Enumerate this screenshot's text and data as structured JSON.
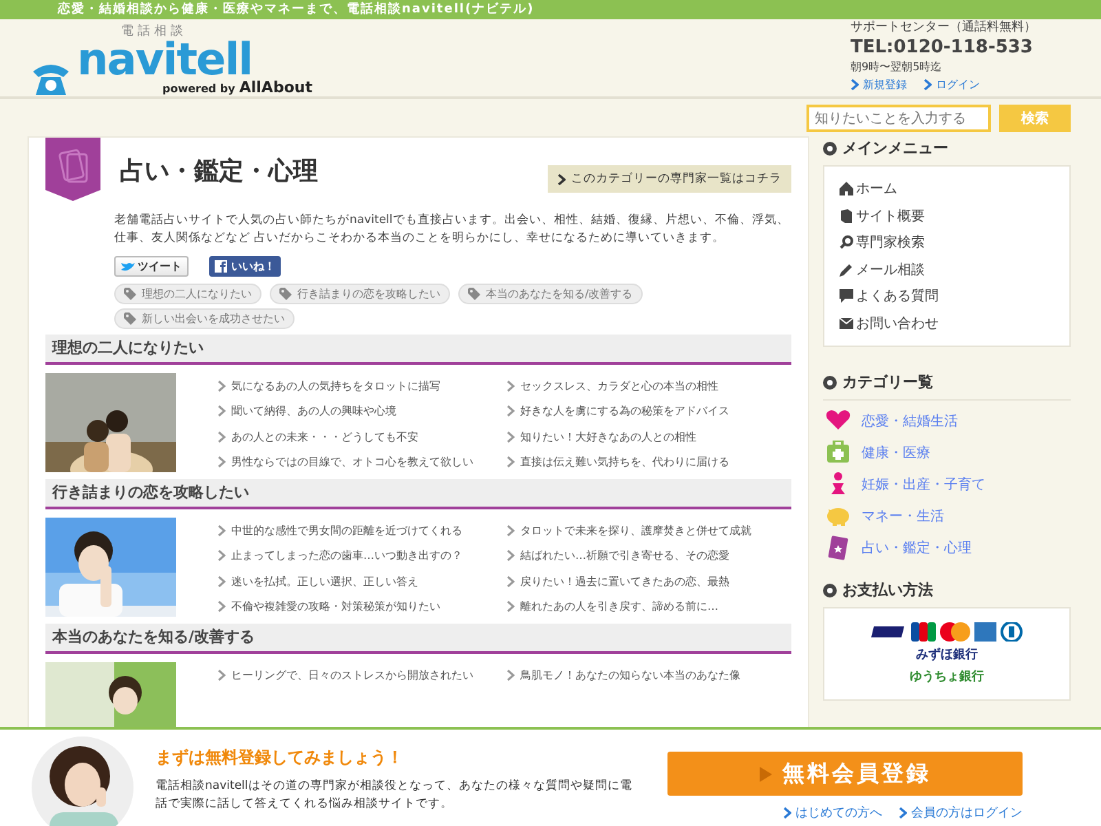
{
  "top_banner": "恋愛・結婚相談から健康・医療やマネーまで、電話相談navitell(ナビテル)",
  "logo": {
    "caption": "電話相談",
    "name": "navitell",
    "powered": "powered by",
    "brand": "AllAbout"
  },
  "support": {
    "title": "サポートセンター（通話料無料）",
    "tel": "TEL:0120-118-533",
    "hours": "朝9時〜翌朝5時迄",
    "links": [
      "新規登録",
      "ログイン"
    ]
  },
  "search": {
    "placeholder": "知りたいことを入力する",
    "button": "検索"
  },
  "category": {
    "title": "占い・鑑定・心理",
    "expert_link": "このカテゴリーの専門家一覧はコチラ",
    "description": "老舗電話占いサイトで人気の占い師たちがnavitellでも直接占います。出会い、相性、結婚、復縁、片想い、不倫、浮気、仕事、友人関係などなど 占いだからこそわかる本当のことを明らかにし、幸せになるために導いていきます。",
    "share": [
      {
        "kind": "tweet",
        "label": "ツイート"
      },
      {
        "kind": "like",
        "label": "いいね！"
      }
    ],
    "tags": [
      "理想の二人になりたい",
      "行き詰まりの恋を攻略したい",
      "本当のあなたを知る/改善する",
      "新しい出会いを成功させたい"
    ]
  },
  "sections": [
    {
      "heading": "理想の二人になりたい",
      "items": [
        "気になるあの人の気持ちをタロットに描写",
        "セックスレス、カラダと心の本当の相性",
        "聞いて納得、あの人の興味や心境",
        "好きな人を虜にする為の秘策をアドバイス",
        "あの人との未来・・・どうしても不安",
        "知りたい！大好きなあの人との相性",
        "男性ならではの目線で、オトコ心を教えて欲しい",
        "直接は伝え難い気持ちを、代わりに届ける"
      ]
    },
    {
      "heading": "行き詰まりの恋を攻略したい",
      "items": [
        "中世的な感性で男女間の距離を近づけてくれる",
        "タロットで未来を探り、護摩焚きと併せて成就",
        "止まってしまった恋の歯車…いつ動き出すの？",
        "結ばれたい…祈願で引き寄せる、その恋愛",
        "迷いを払拭。正しい選択、正しい答え",
        "戻りたい！過去に置いてきたあの恋、最熱",
        "不倫や複雑愛の攻略・対策秘策が知りたい",
        "離れたあの人を引き戻す、諦める前に…"
      ]
    },
    {
      "heading": "本当のあなたを知る/改善する",
      "items": [
        "ヒーリングで、日々のストレスから開放されたい",
        "鳥肌モノ！あなたの知らない本当のあなた像"
      ]
    }
  ],
  "sidebar": {
    "main_menu": {
      "title": "メインメニュー",
      "items": [
        {
          "kind": "home",
          "label": "ホーム"
        },
        {
          "kind": "book",
          "label": "サイト概要"
        },
        {
          "kind": "search",
          "label": "専門家検索"
        },
        {
          "kind": "pencil",
          "label": "メール相談"
        },
        {
          "kind": "chat",
          "label": "よくある質問"
        },
        {
          "kind": "mail",
          "label": "お問い合わせ"
        }
      ]
    },
    "categories": {
      "title": "カテゴリー覧",
      "items": [
        {
          "kind": "heart",
          "label": "恋愛・結婚生活"
        },
        {
          "kind": "medical",
          "label": "健康・医療"
        },
        {
          "kind": "baby",
          "label": "妊娠・出産・子育て"
        },
        {
          "kind": "piggy",
          "label": "マネー・生活"
        },
        {
          "kind": "card",
          "label": "占い・鑑定・心理"
        }
      ]
    },
    "payment": {
      "title": "お支払い方法",
      "banks": [
        {
          "label": "みずほ銀行",
          "color": "#1d2f7a"
        },
        {
          "label": "ゆうちょ銀行",
          "color": "#2e8b2e"
        }
      ]
    }
  },
  "signup_bar": {
    "title": "まずは無料登録してみましょう！",
    "text": "電話相談navitellはその道の専門家が相談役となって、あなたの様々な質問や疑問に電話で実際に話して答えてくれる悩み相談サイトです。",
    "button": "無料会員登録",
    "links": [
      "はじめての方へ",
      "会員の方はログイン"
    ]
  }
}
